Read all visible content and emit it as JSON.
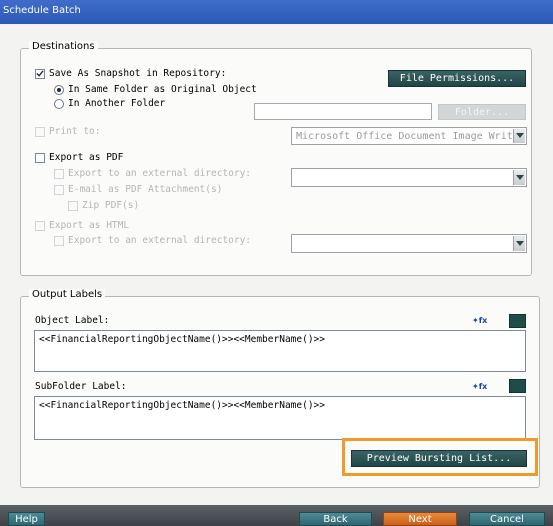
{
  "window": {
    "title": "Schedule Batch"
  },
  "destinations": {
    "legend": "Destinations",
    "save_snapshot": {
      "label": "Save As Snapshot in Repository:",
      "checked": true
    },
    "radio_same_folder": {
      "label": "In Same Folder as Original Object",
      "selected": true
    },
    "radio_another_folder": {
      "label": "In Another Folder",
      "selected": false
    },
    "file_permissions_button": "File Permissions...",
    "folder_button": "Folder...",
    "print_to": {
      "label": "Print to:",
      "enabled": false
    },
    "printer_select": {
      "value": "Microsoft Office Document Image Writer"
    },
    "export_pdf": {
      "label": "Export as PDF",
      "checked": false
    },
    "pdf_export_external": {
      "label": "Export to an external directory:"
    },
    "pdf_email": {
      "label": "E-mail as PDF Attachment(s)"
    },
    "pdf_zip": {
      "label": "Zip PDF(s)"
    },
    "export_html": {
      "label": "Export as HTML",
      "enabled": false
    },
    "html_export_external": {
      "label": "Export to an external directory:"
    }
  },
  "output_labels": {
    "legend": "Output Labels",
    "object_label": {
      "label": "Object Label:",
      "value": "<<FinancialReportingObjectName()>><<MemberName()>>"
    },
    "subfolder_label": {
      "label": "SubFolder Label:",
      "value": "<<FinancialReportingObjectName()>><<MemberName()>>"
    },
    "insert_function_icon_text": "✦fx",
    "preview_bursting_button": "Preview Bursting List..."
  },
  "footer": {
    "help": "Help",
    "back": "Back",
    "next": "Next",
    "cancel": "Cancel"
  },
  "colors": {
    "title_bar": "#2c59b7",
    "button_teal": "#2a5454",
    "highlight_orange": "#f09a2a",
    "next_orange": "#d36d22"
  }
}
